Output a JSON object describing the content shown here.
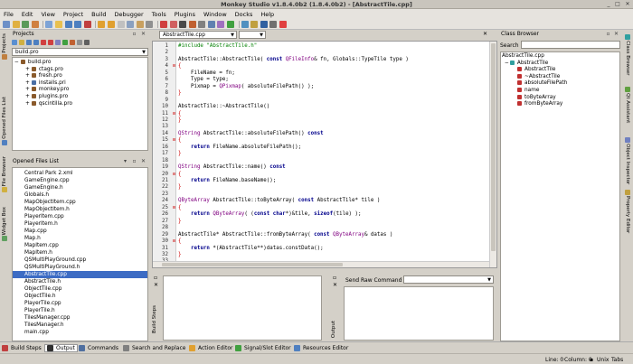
{
  "window": {
    "title": "Monkey Studio v1.8.4.0b2 (1.8.4.0b2) - [AbstractTile.cpp]",
    "min": "_",
    "max": "□",
    "close": "✕"
  },
  "menu": [
    "File",
    "Edit",
    "View",
    "Project",
    "Build",
    "Debugger",
    "Tools",
    "Plugins",
    "Window",
    "Docks",
    "Help"
  ],
  "left_tabs": [
    "Projects",
    "Opened Files List",
    "File Browser",
    "Widget Box"
  ],
  "right_tabs": [
    "Class Browser",
    "Qt Assistant",
    "Object Inspector",
    "Property Editor"
  ],
  "projects": {
    "title": "Projects",
    "combo": "build.pro",
    "items": [
      {
        "label": "build.pro",
        "type": "pro"
      },
      {
        "label": "ctags.pro",
        "type": "pro"
      },
      {
        "label": "fresh.pro",
        "type": "pro"
      },
      {
        "label": "installs.pri",
        "type": "pri"
      },
      {
        "label": "monkey.pro",
        "type": "pro"
      },
      {
        "label": "plugins.pro",
        "type": "pro"
      },
      {
        "label": "qscintilla.pro",
        "type": "pro"
      }
    ]
  },
  "opened_files": {
    "title": "Opened Files List",
    "items": [
      "Central Park 2.xml",
      "GameEngine.cpp",
      "GameEngine.h",
      "Globals.h",
      "MapObjectItem.cpp",
      "MapObjectItem.h",
      "PlayerItem.cpp",
      "PlayerItem.h",
      "Map.cpp",
      "Map.h",
      "MapItem.cpp",
      "MapItem.h",
      "QSMultiPlayGround.cpp",
      "QSMultiPlayGround.h",
      "AbstractTile.cpp",
      "AbstractTile.h",
      "ObjectTile.cpp",
      "ObjectTile.h",
      "PlayerTile.cpp",
      "PlayerTile.h",
      "TilesManager.cpp",
      "TilesManager.h",
      "main.cpp"
    ],
    "selected": "AbstractTile.cpp"
  },
  "editor": {
    "file_combo": "AbstractTile.cpp",
    "symbol_combo": "",
    "lines": [
      {
        "n": "1",
        "t": "#include \"AbstractTile.h\""
      },
      {
        "n": "2",
        "t": ""
      },
      {
        "n": "3",
        "t": "AbstractTile::AbstractTile( const QFileInfo& fn, Globals::TypeTile type )"
      },
      {
        "n": "4",
        "t": "{"
      },
      {
        "n": "5",
        "t": "    FileName = fn;"
      },
      {
        "n": "6",
        "t": "    Type = type;"
      },
      {
        "n": "7",
        "t": "    Pixmap = QPixmap( absoluteFilePath() );"
      },
      {
        "n": "8",
        "t": "}"
      },
      {
        "n": "9",
        "t": ""
      },
      {
        "n": "10",
        "t": "AbstractTile::~AbstractTile()"
      },
      {
        "n": "11",
        "t": "{"
      },
      {
        "n": "12",
        "t": "}"
      },
      {
        "n": "13",
        "t": ""
      },
      {
        "n": "14",
        "t": "QString AbstractTile::absoluteFilePath() const"
      },
      {
        "n": "15",
        "t": "{"
      },
      {
        "n": "16",
        "t": "    return FileName.absoluteFilePath();"
      },
      {
        "n": "17",
        "t": "}"
      },
      {
        "n": "18",
        "t": ""
      },
      {
        "n": "19",
        "t": "QString AbstractTile::name() const"
      },
      {
        "n": "20",
        "t": "{"
      },
      {
        "n": "21",
        "t": "    return FileName.baseName();"
      },
      {
        "n": "22",
        "t": "}"
      },
      {
        "n": "23",
        "t": ""
      },
      {
        "n": "24",
        "t": "QByteArray AbstractTile::toByteArray( const AbstractTile* tile )"
      },
      {
        "n": "25",
        "t": "{"
      },
      {
        "n": "26",
        "t": "    return QByteArray( (const char*)&tile, sizeof(tile) );"
      },
      {
        "n": "27",
        "t": "}"
      },
      {
        "n": "28",
        "t": ""
      },
      {
        "n": "29",
        "t": "AbstractTile* AbstractTile::fromByteArray( const QByteArray& datas )"
      },
      {
        "n": "30",
        "t": "{"
      },
      {
        "n": "31",
        "t": "    return *(AbstractTile**)datas.constData();"
      },
      {
        "n": "32",
        "t": "}"
      },
      {
        "n": "33",
        "t": ""
      }
    ]
  },
  "class_browser": {
    "title": "Class Browser",
    "search_label": "Search",
    "search_value": "",
    "file": "AbstractTile.cpp",
    "class": "AbstractTile",
    "members": [
      "AbstractTile",
      "~AbstractTile",
      "absoluteFilePath",
      "name",
      "toByteArray",
      "fromByteArray"
    ]
  },
  "bottom": {
    "build_steps_label": "Build Steps",
    "output_label": "Output",
    "send_raw_label": "Send Raw Command :",
    "send_raw_value": ""
  },
  "bottom_tabs": [
    "Build Steps",
    "Output",
    "Commands",
    "Search and Replace",
    "Action Editor",
    "Signal/Slot Editor",
    "Resources Editor"
  ],
  "status": {
    "line": "Line: 0",
    "column": "Column: 0",
    "mode": "Unix",
    "indent": "Tabs"
  }
}
